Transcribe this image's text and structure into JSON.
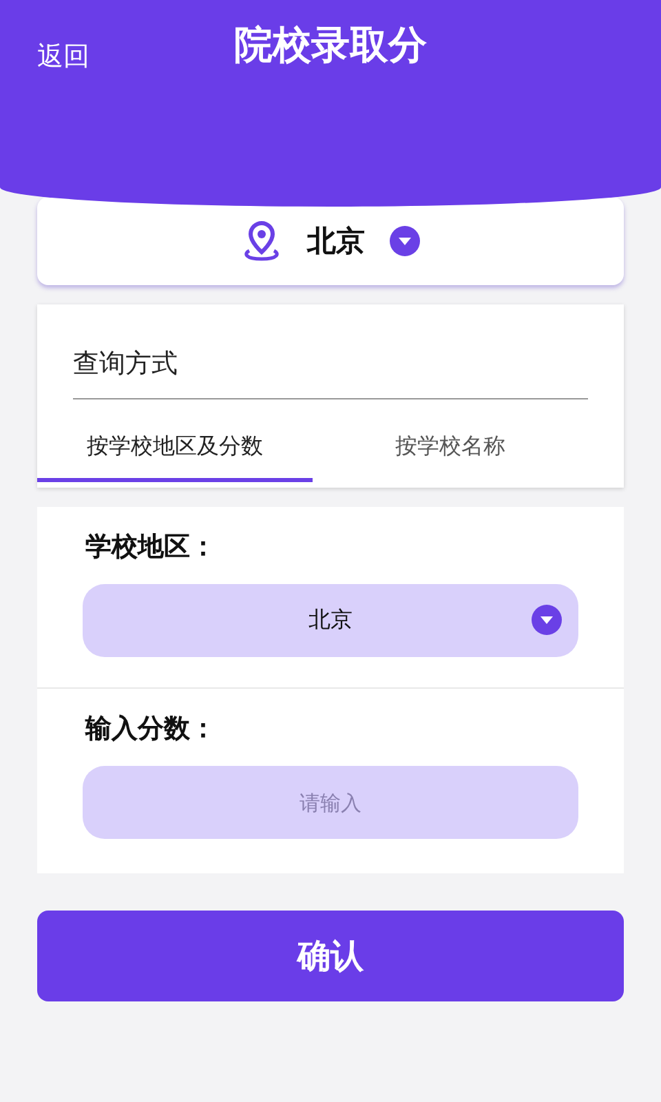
{
  "header": {
    "back": "返回",
    "title": "院校录取分"
  },
  "location": {
    "city": "北京"
  },
  "query": {
    "label": "查询方式",
    "tabs": [
      {
        "label": "按学校地区及分数",
        "selected": true
      },
      {
        "label": "按学校名称",
        "selected": false
      }
    ]
  },
  "form": {
    "region_label": "学校地区：",
    "region_value": "北京",
    "score_label": "输入分数：",
    "score_placeholder": "请输入"
  },
  "confirm": "确认"
}
